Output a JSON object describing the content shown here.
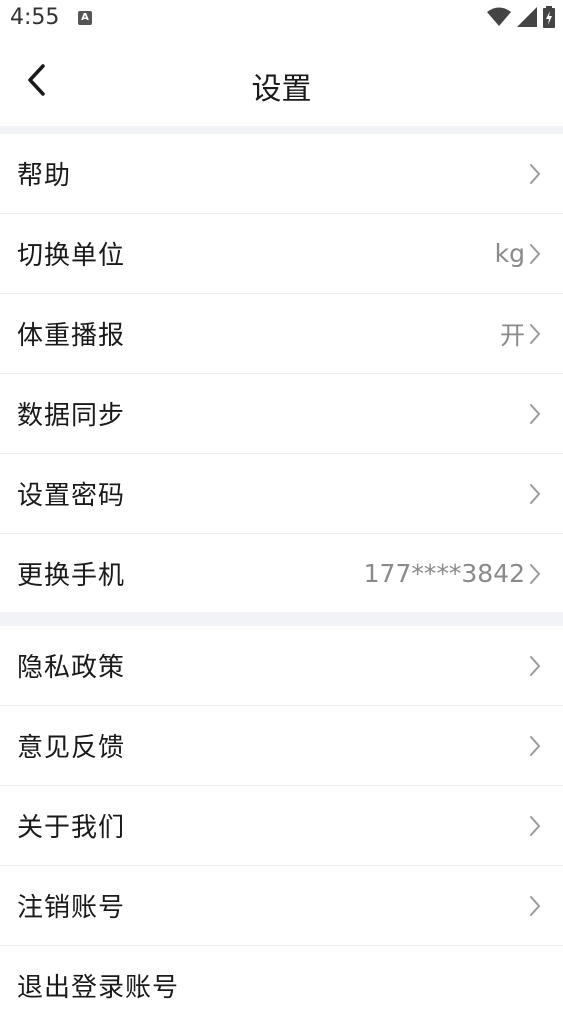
{
  "status_bar": {
    "time": "4:55",
    "notification_icon": "a-app-icon",
    "icons": [
      "wifi-icon",
      "signal-icon",
      "battery-charging-icon"
    ]
  },
  "header": {
    "title": "设置",
    "back_icon": "back-arrow-icon"
  },
  "colors": {
    "background": "#ffffff",
    "section_gap": "#f2f3f7",
    "text_primary": "#1a1a1a",
    "text_secondary": "#8a8a8a",
    "divider": "#ededed",
    "chevron": "#999999"
  },
  "group1": {
    "items": [
      {
        "label": "帮助",
        "value": ""
      },
      {
        "label": "切换单位",
        "value": "kg"
      },
      {
        "label": "体重播报",
        "value": "开"
      },
      {
        "label": "数据同步",
        "value": ""
      },
      {
        "label": "设置密码",
        "value": ""
      },
      {
        "label": "更换手机",
        "value": "177****3842"
      }
    ]
  },
  "group2": {
    "items": [
      {
        "label": "隐私政策",
        "value": ""
      },
      {
        "label": "意见反馈",
        "value": ""
      },
      {
        "label": "关于我们",
        "value": ""
      },
      {
        "label": "注销账号",
        "value": ""
      },
      {
        "label": "退出登录账号",
        "value": ""
      }
    ]
  }
}
